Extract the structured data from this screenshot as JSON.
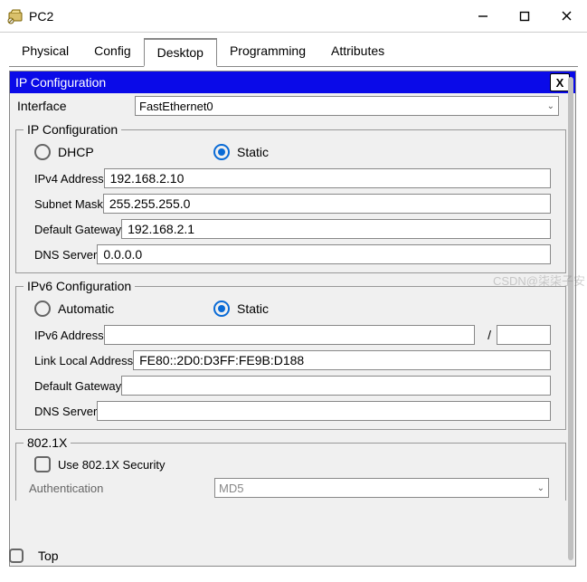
{
  "window": {
    "title": "PC2"
  },
  "tabs": {
    "physical": "Physical",
    "config": "Config",
    "desktop": "Desktop",
    "programming": "Programming",
    "attributes": "Attributes"
  },
  "panel": {
    "title": "IP Configuration",
    "close": "X"
  },
  "interface": {
    "label": "Interface",
    "value": "FastEthernet0"
  },
  "ipcfg": {
    "legend": "IP Configuration",
    "dhcp": "DHCP",
    "static": "Static",
    "ipv4_label": "IPv4 Address",
    "ipv4": "192.168.2.10",
    "subnet_label": "Subnet Mask",
    "subnet": "255.255.255.0",
    "gw_label": "Default Gateway",
    "gw": "192.168.2.1",
    "dns_label": "DNS Server",
    "dns": "0.0.0.0"
  },
  "ipv6cfg": {
    "legend": "IPv6 Configuration",
    "auto": "Automatic",
    "static": "Static",
    "addr_label": "IPv6 Address",
    "addr": "",
    "prefix": "",
    "ll_label": "Link Local Address",
    "ll": "FE80::2D0:D3FF:FE9B:D188",
    "gw_label": "Default Gateway",
    "gw": "",
    "dns_label": "DNS Server",
    "dns": ""
  },
  "dot1x": {
    "legend": "802.1X",
    "use": "Use 802.1X Security",
    "auth_label": "Authentication",
    "auth": "MD5"
  },
  "footer": {
    "top": "Top"
  },
  "watermark": "CSDN@柒柒子安"
}
